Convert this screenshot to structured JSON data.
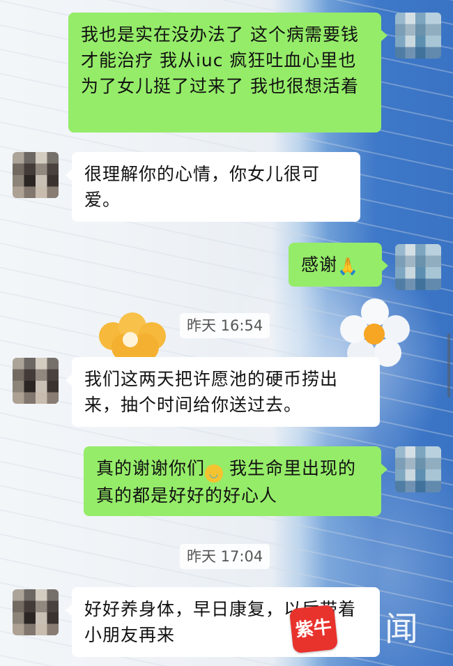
{
  "chat": {
    "messages": [
      {
        "side": "out",
        "text": "我也是实在没办法了 这个病需要钱才能治疗 我从iuc 疯狂吐血心里也为了女儿挺了过来了 我也很想活着"
      },
      {
        "side": "in",
        "text": "很理解你的心情，你女儿很可爱。"
      },
      {
        "side": "out",
        "text": "感谢",
        "emoji": "🙏"
      },
      {
        "type": "time",
        "text": "昨天 16:54"
      },
      {
        "side": "in",
        "text": "我们这两天把许愿池的硬币捞出来，抽个时间给你送过去。"
      },
      {
        "side": "out",
        "text_before": "真的谢谢你们",
        "emoji": "😭",
        "text_after": " 我生命里出现的真的都是好好的好心人"
      },
      {
        "type": "time",
        "text": "昨天 17:04"
      },
      {
        "side": "in",
        "text": "好好养身体，早日康复，以后带着小朋友再来"
      }
    ]
  },
  "watermark": {
    "logo_text": "紫牛",
    "char": "闻"
  }
}
